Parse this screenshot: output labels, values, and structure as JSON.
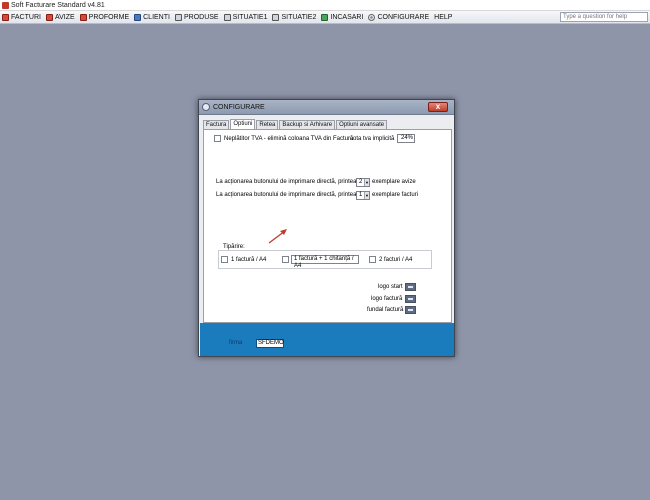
{
  "window": {
    "title": "Soft Facturare Standard v4.81"
  },
  "menu": {
    "items": [
      {
        "label": "FACTURI"
      },
      {
        "label": "AVIZE"
      },
      {
        "label": "PROFORME"
      },
      {
        "label": "CLIENTI"
      },
      {
        "label": "PRODUSE"
      },
      {
        "label": "SITUATIE1"
      },
      {
        "label": "SITUATIE2"
      },
      {
        "label": "INCASARI"
      },
      {
        "label": "CONFIGURARE"
      },
      {
        "label": "HELP"
      }
    ],
    "help_placeholder": "Type a question for help"
  },
  "dialog": {
    "title": "CONFIGURARE",
    "close": "x",
    "tabs": [
      "Factura",
      "Optiuni",
      "Retea",
      "Backup si Arhivare",
      "Optiuni avansate"
    ],
    "active_tab": "Optiuni",
    "neplatitor_label": "Neplătitor TVA - elimină coloana TVA din Factură",
    "cota_label": "cota tva implicită",
    "cota_value": "24%",
    "print_avize": {
      "prefix": "La acționarea butonului de imprimare directă, printează:",
      "value": "2",
      "suffix": "exemplare avize"
    },
    "print_facturi": {
      "prefix": "La acționarea butonului de imprimare directă, printează:",
      "value": "1",
      "suffix": "exemplare facturi"
    },
    "tiparire": {
      "title": "Tipărire:",
      "options": [
        "1 factură / A4",
        "1 factură + 1 chitanță / A4",
        "2 facturi / A4"
      ]
    },
    "images": {
      "logo_start": "logo start",
      "logo_factura": "logo factură",
      "fundal_factura": "fundal factură"
    },
    "footer": {
      "firma_label": "firma",
      "firma_value": "SFDEMO"
    }
  },
  "colors": {
    "desktop": "#8e95a9",
    "footer": "#1a7bbd",
    "arrow": "#c0392b"
  }
}
